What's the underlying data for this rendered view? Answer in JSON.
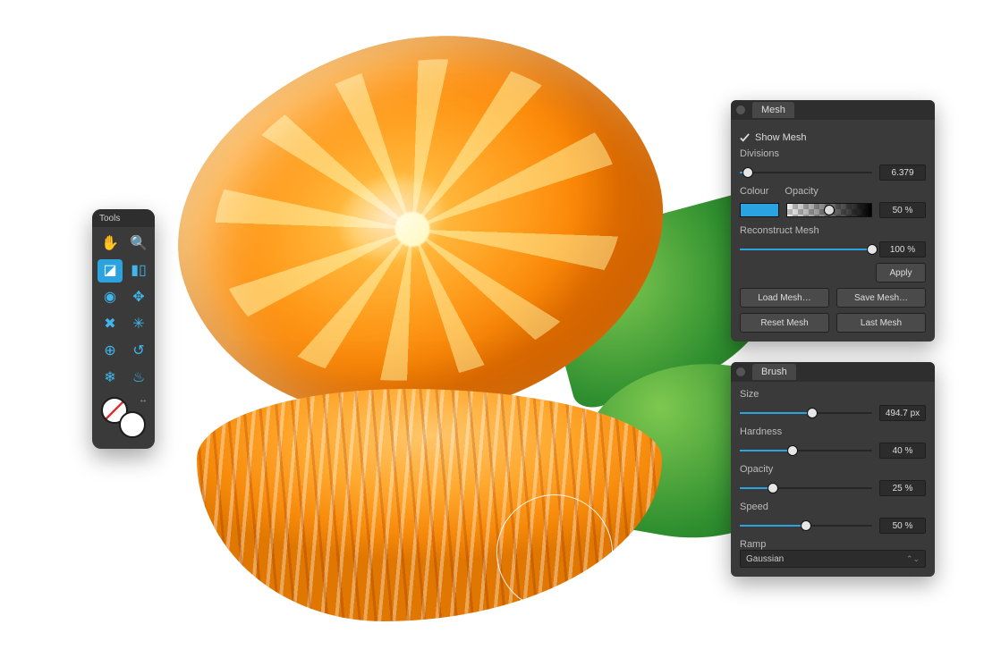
{
  "tools_panel": {
    "title": "Tools",
    "items": [
      {
        "name": "hand-tool",
        "icon": "✋"
      },
      {
        "name": "zoom-tool",
        "icon": "🔍"
      },
      {
        "name": "liquify-push-tool",
        "icon": "◪",
        "selected": true
      },
      {
        "name": "liquify-mirror-tool",
        "icon": "▮▯"
      },
      {
        "name": "twirl-tool",
        "icon": "◉"
      },
      {
        "name": "pinch-tool",
        "icon": "✥"
      },
      {
        "name": "punch-tool",
        "icon": "✖"
      },
      {
        "name": "turbulence-tool",
        "icon": "✳"
      },
      {
        "name": "mesh-tool",
        "icon": "⊕"
      },
      {
        "name": "reconstruct-tool",
        "icon": "↺"
      },
      {
        "name": "freeze-tool",
        "icon": "❄"
      },
      {
        "name": "thaw-tool",
        "icon": "♨"
      }
    ],
    "swap_label": "↔"
  },
  "mesh": {
    "tab": "Mesh",
    "show_mesh_label": "Show Mesh",
    "show_mesh_checked": true,
    "divisions_label": "Divisions",
    "divisions_value": "6.379",
    "divisions_pct": 6,
    "colour_label": "Colour",
    "colour_hex": "#2aa3e0",
    "opacity_label": "Opacity",
    "opacity_value": "50 %",
    "opacity_pct": 50,
    "reconstruct_label": "Reconstruct Mesh",
    "reconstruct_value": "100 %",
    "reconstruct_pct": 100,
    "apply_label": "Apply",
    "buttons": {
      "load": "Load Mesh…",
      "save": "Save Mesh…",
      "reset": "Reset Mesh",
      "last": "Last Mesh"
    }
  },
  "brush": {
    "tab": "Brush",
    "size_label": "Size",
    "size_value": "494.7 px",
    "size_pct": 55,
    "hardness_label": "Hardness",
    "hardness_value": "40 %",
    "hardness_pct": 40,
    "opacity_label": "Opacity",
    "opacity_value": "25 %",
    "opacity_pct": 25,
    "speed_label": "Speed",
    "speed_value": "50 %",
    "speed_pct": 50,
    "ramp_label": "Ramp",
    "ramp_value": "Gaussian"
  }
}
